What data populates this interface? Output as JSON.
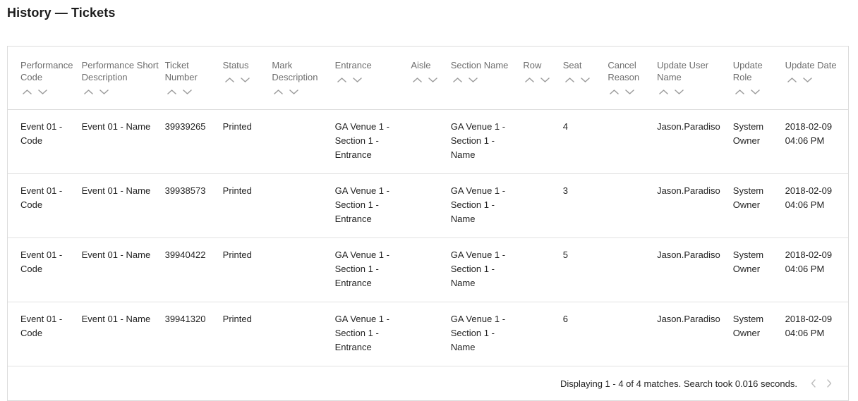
{
  "page": {
    "title": "History — Tickets"
  },
  "table": {
    "columns": [
      {
        "key": "performance_code",
        "label": "Performance Code",
        "sortable": true,
        "up_icon": "chevron-up-icon",
        "down_icon": "chevron-down-icon"
      },
      {
        "key": "performance_short_desc",
        "label": "Performance Short Description",
        "sortable": true,
        "up_icon": "chevron-up-icon",
        "down_icon": "chevron-down-icon"
      },
      {
        "key": "ticket_number",
        "label": "Ticket Number",
        "sortable": true,
        "up_icon": "chevron-up-icon",
        "down_icon": "chevron-down-icon"
      },
      {
        "key": "status",
        "label": "Status",
        "sortable": true,
        "up_icon": "chevron-up-icon",
        "down_icon": "chevron-down-icon"
      },
      {
        "key": "mark_description",
        "label": "Mark Description",
        "sortable": true,
        "up_icon": "chevron-up-icon",
        "down_icon": "chevron-down-icon"
      },
      {
        "key": "entrance",
        "label": "Entrance",
        "sortable": true,
        "up_icon": "chevron-up-icon",
        "down_icon": "chevron-down-icon"
      },
      {
        "key": "aisle",
        "label": "Aisle",
        "sortable": true,
        "up_icon": "chevron-up-icon",
        "down_icon": "chevron-down-icon"
      },
      {
        "key": "section_name",
        "label": "Section Name",
        "sortable": true,
        "up_icon": "chevron-up-icon",
        "down_icon": "chevron-down-icon"
      },
      {
        "key": "row",
        "label": "Row",
        "sortable": true,
        "up_icon": "chevron-up-icon",
        "down_icon": "chevron-down-icon"
      },
      {
        "key": "seat",
        "label": "Seat",
        "sortable": true,
        "up_icon": "chevron-up-icon",
        "down_icon": "chevron-down-icon"
      },
      {
        "key": "cancel_reason",
        "label": "Cancel Reason",
        "sortable": true,
        "up_icon": "chevron-up-icon",
        "down_icon": "chevron-down-icon"
      },
      {
        "key": "update_user_name",
        "label": "Update User Name",
        "sortable": true,
        "up_icon": "chevron-up-icon",
        "down_icon": "chevron-down-icon"
      },
      {
        "key": "update_role",
        "label": "Update Role",
        "sortable": true,
        "up_icon": "chevron-up-icon",
        "down_icon": "chevron-down-icon"
      },
      {
        "key": "update_date",
        "label": "Update Date",
        "sortable": true,
        "up_icon": "chevron-up-icon",
        "down_icon": "chevron-down-icon"
      }
    ],
    "rows": [
      {
        "performance_code": "Event 01 - Code",
        "performance_short_desc": "Event 01 - Name",
        "ticket_number": "39939265",
        "status": "Printed",
        "mark_description": "",
        "entrance": "GA Venue 1 - Section 1 - Entrance",
        "aisle": "",
        "section_name": "GA Venue 1 - Section 1 - Name",
        "row": "",
        "seat": "4",
        "cancel_reason": "",
        "update_user_name": "Jason.Paradiso",
        "update_role": "System Owner",
        "update_date": "2018-02-09 04:06 PM"
      },
      {
        "performance_code": "Event 01 - Code",
        "performance_short_desc": "Event 01 - Name",
        "ticket_number": "39938573",
        "status": "Printed",
        "mark_description": "",
        "entrance": "GA Venue 1 - Section 1 - Entrance",
        "aisle": "",
        "section_name": "GA Venue 1 - Section 1 - Name",
        "row": "",
        "seat": "3",
        "cancel_reason": "",
        "update_user_name": "Jason.Paradiso",
        "update_role": "System Owner",
        "update_date": "2018-02-09 04:06 PM"
      },
      {
        "performance_code": "Event 01 - Code",
        "performance_short_desc": "Event 01 - Name",
        "ticket_number": "39940422",
        "status": "Printed",
        "mark_description": "",
        "entrance": "GA Venue 1 - Section 1 - Entrance",
        "aisle": "",
        "section_name": "GA Venue 1 - Section 1 - Name",
        "row": "",
        "seat": "5",
        "cancel_reason": "",
        "update_user_name": "Jason.Paradiso",
        "update_role": "System Owner",
        "update_date": "2018-02-09 04:06 PM"
      },
      {
        "performance_code": "Event 01 - Code",
        "performance_short_desc": "Event 01 - Name",
        "ticket_number": "39941320",
        "status": "Printed",
        "mark_description": "",
        "entrance": "GA Venue 1 - Section 1 - Entrance",
        "aisle": "",
        "section_name": "GA Venue 1 - Section 1 - Name",
        "row": "",
        "seat": "6",
        "cancel_reason": "",
        "update_user_name": "Jason.Paradiso",
        "update_role": "System Owner",
        "update_date": "2018-02-09 04:06 PM"
      }
    ]
  },
  "footer": {
    "status_text": "Displaying 1 - 4 of 4 matches. Search took 0.016 seconds.",
    "prev_icon": "chevron-left-icon",
    "next_icon": "chevron-right-icon"
  },
  "colors": {
    "border": "#dcdcdc",
    "row_border": "#e2e2e2",
    "header_text": "#6e6e6e",
    "body_text": "#232323",
    "title_text": "#1c1c1c",
    "icon_gray": "#9b9b9b",
    "page_bg": "#ffffff"
  }
}
